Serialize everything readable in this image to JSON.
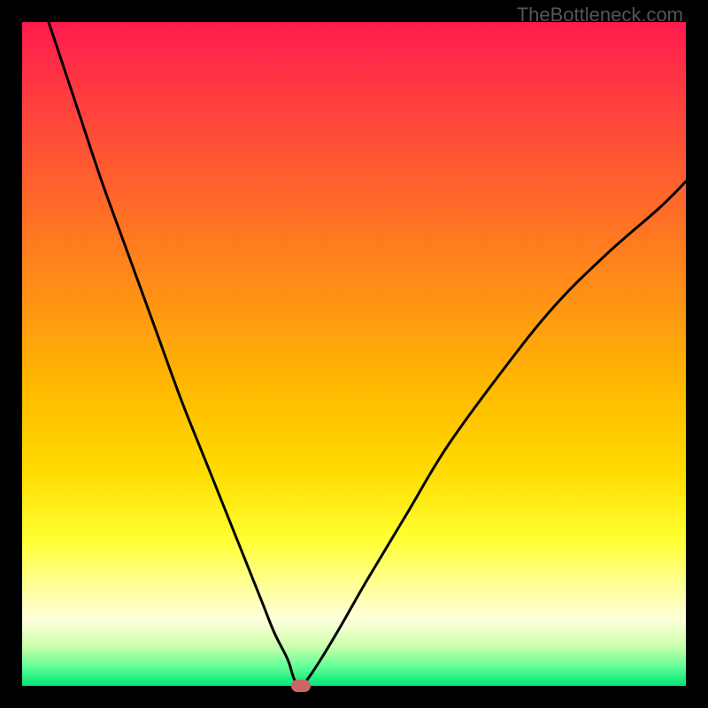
{
  "watermark": "TheBottleneck.com",
  "chart_data": {
    "type": "line",
    "title": "",
    "xlabel": "",
    "ylabel": "",
    "xlim": [
      0,
      100
    ],
    "ylim": [
      0,
      100
    ],
    "series": [
      {
        "name": "bottleneck-curve",
        "x": [
          4,
          8,
          12,
          16,
          20,
          24,
          28,
          32,
          36,
          38,
          40,
          41,
          42,
          43,
          45,
          48,
          52,
          58,
          64,
          72,
          80,
          88,
          96,
          100
        ],
        "y": [
          100,
          88,
          76,
          65,
          54,
          43,
          33,
          23,
          13,
          8,
          4,
          1,
          0,
          1,
          4,
          9,
          16,
          26,
          36,
          47,
          57,
          65,
          72,
          76
        ]
      }
    ],
    "marker": {
      "x": 42,
      "y": 0
    },
    "gradient_stops": [
      {
        "pos": 0,
        "color": "#ff1a4d"
      },
      {
        "pos": 8,
        "color": "#ff3344"
      },
      {
        "pos": 20,
        "color": "#ff5533"
      },
      {
        "pos": 32,
        "color": "#ff7722"
      },
      {
        "pos": 44,
        "color": "#ff9911"
      },
      {
        "pos": 56,
        "color": "#ffbb00"
      },
      {
        "pos": 68,
        "color": "#ffdd00"
      },
      {
        "pos": 78,
        "color": "#ffff33"
      },
      {
        "pos": 85,
        "color": "#ffff99"
      },
      {
        "pos": 90,
        "color": "#ffffdd"
      },
      {
        "pos": 94,
        "color": "#ccffaa"
      },
      {
        "pos": 97,
        "color": "#66ff99"
      },
      {
        "pos": 100,
        "color": "#00e676"
      }
    ]
  }
}
